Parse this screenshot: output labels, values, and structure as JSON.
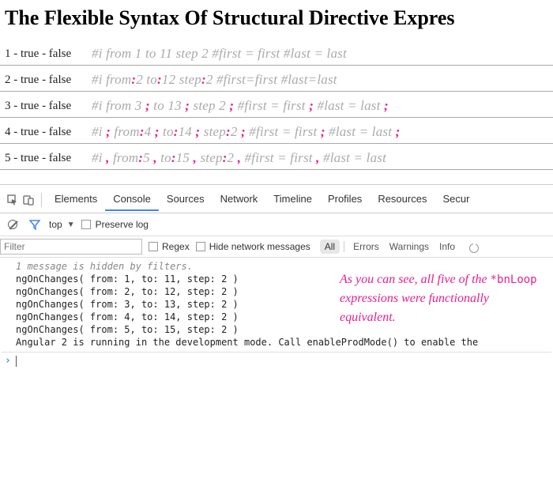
{
  "heading": "The Flexible Syntax Of Structural Directive Expres",
  "rows": [
    {
      "label": "1 - true - false",
      "parts": [
        "#i from 1 to 11 step 2 #first = first #last = last"
      ],
      "puncs": []
    },
    {
      "label": "2 - true - false",
      "parts": [
        "#i from",
        ":",
        "2 to",
        ":",
        "12 step",
        ":",
        "2 #first=first #last=last"
      ],
      "puncs": [
        1,
        3,
        5
      ]
    },
    {
      "label": "3 - true - false",
      "parts": [
        "#i from 3 ",
        ";",
        " to 13 ",
        ";",
        " step 2 ",
        ";",
        " #first = first ",
        ";",
        " #last = last ",
        ";"
      ],
      "puncs": [
        1,
        3,
        5,
        7,
        9
      ]
    },
    {
      "label": "4 - true - false",
      "parts": [
        "#i ",
        ";",
        " from",
        ":",
        "4 ",
        ";",
        " to",
        ":",
        "14 ",
        ";",
        " step",
        ":",
        "2 ",
        ";",
        " #first = first ",
        ";",
        " #last = last ",
        ";"
      ],
      "puncs": [
        1,
        3,
        5,
        7,
        9,
        11,
        13,
        15,
        17
      ]
    },
    {
      "label": "5 - true - false",
      "parts": [
        "#i ",
        ",",
        " from",
        ":",
        "5 ",
        ",",
        " to",
        ":",
        "15 ",
        ",",
        " step",
        ":",
        "2 ",
        ",",
        " #first = first ",
        ",",
        " #last = last"
      ],
      "puncs": [
        1,
        3,
        5,
        7,
        9,
        11,
        13,
        15
      ]
    }
  ],
  "devtools": {
    "tabs": [
      "Elements",
      "Console",
      "Sources",
      "Network",
      "Timeline",
      "Profiles",
      "Resources",
      "Secur"
    ],
    "activeTab": "Console",
    "context": "top",
    "preserve_log_label": "Preserve log",
    "filter_placeholder": "Filter",
    "regex_label": "Regex",
    "hide_net_label": "Hide network messages",
    "levels": [
      "All",
      "Errors",
      "Warnings",
      "Info"
    ],
    "levels_active": "All",
    "hidden_msg": "1 message is hidden by filters.",
    "lines": [
      "ngOnChanges( from: 1, to: 11, step: 2 )",
      "ngOnChanges( from: 2, to: 12, step: 2 )",
      "ngOnChanges( from: 3, to: 13, step: 2 )",
      "ngOnChanges( from: 4, to: 14, step: 2 )",
      "ngOnChanges( from: 5, to: 15, step: 2 )",
      "Angular 2 is running in the development mode. Call enableProdMode() to enable the"
    ],
    "annotation": {
      "pre": "As you can see, all five of the ",
      "code": "*bnLoop",
      "post": " expressions were functionally equivalent."
    }
  }
}
